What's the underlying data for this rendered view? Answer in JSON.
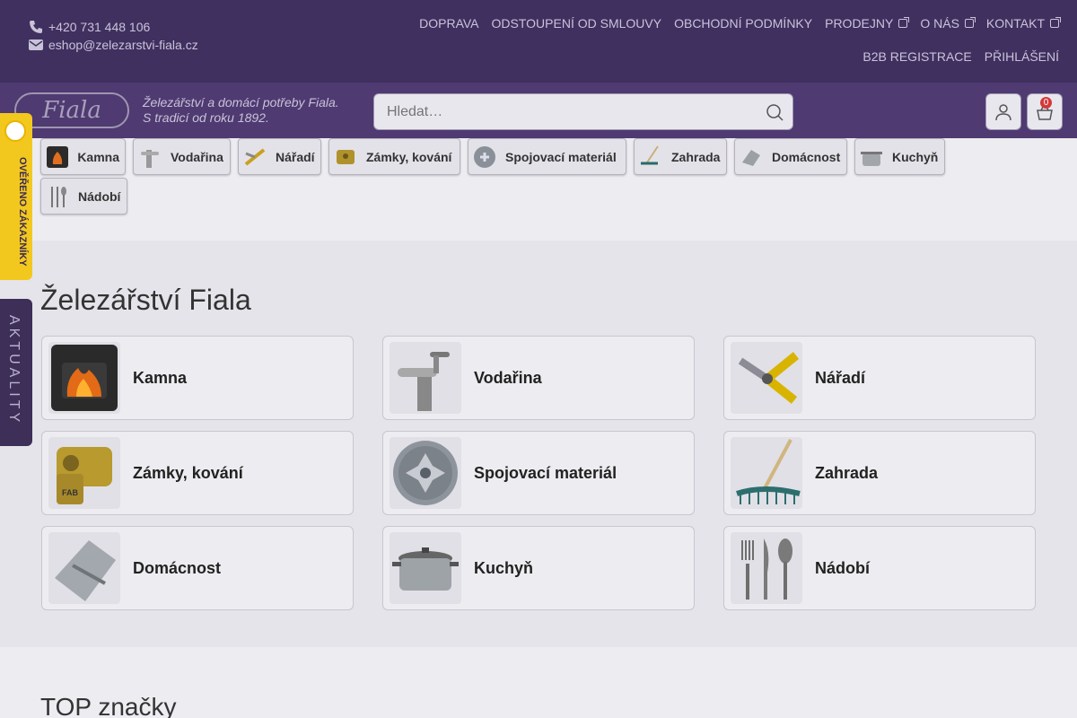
{
  "contact": {
    "phone": "+420 731 448 106",
    "email": "eshop@zelezarstvi-fiala.cz"
  },
  "topnav": [
    {
      "label": "DOPRAVA",
      "ext": false
    },
    {
      "label": "ODSTOUPENÍ OD SMLOUVY",
      "ext": false
    },
    {
      "label": "OBCHODNÍ PODMÍNKY",
      "ext": false
    },
    {
      "label": "PRODEJNY",
      "ext": true
    },
    {
      "label": "O NÁS",
      "ext": true
    },
    {
      "label": "KONTAKT",
      "ext": true
    }
  ],
  "subnav": [
    {
      "label": "B2B REGISTRACE"
    },
    {
      "label": "PŘIHLÁŠENÍ"
    }
  ],
  "logo": {
    "text": "Fiala"
  },
  "tagline": {
    "line1": "Železářství a domácí potřeby Fiala.",
    "line2": "S tradicí od roku 1892."
  },
  "search": {
    "placeholder": "Hledat…"
  },
  "cart": {
    "count": "0"
  },
  "pills": [
    {
      "label": "Kamna",
      "icon": "stove-icon"
    },
    {
      "label": "Vodařina",
      "icon": "faucet-icon"
    },
    {
      "label": "Nářadí",
      "icon": "pliers-icon"
    },
    {
      "label": "Zámky, kování",
      "icon": "lock-icon"
    },
    {
      "label": "Spojovací materiál",
      "icon": "screw-icon"
    },
    {
      "label": "Zahrada",
      "icon": "rake-icon"
    },
    {
      "label": "Domácnost",
      "icon": "dustpan-icon"
    },
    {
      "label": "Kuchyň",
      "icon": "pot-icon"
    },
    {
      "label": "Nádobí",
      "icon": "cutlery-icon"
    }
  ],
  "main": {
    "title": "Železářství Fiala",
    "cards": [
      {
        "label": "Kamna",
        "icon": "stove-icon"
      },
      {
        "label": "Vodařina",
        "icon": "faucet-icon"
      },
      {
        "label": "Nářadí",
        "icon": "pliers-icon"
      },
      {
        "label": "Zámky, kování",
        "icon": "lock-icon"
      },
      {
        "label": "Spojovací materiál",
        "icon": "screw-icon"
      },
      {
        "label": "Zahrada",
        "icon": "rake-icon"
      },
      {
        "label": "Domácnost",
        "icon": "dustpan-icon"
      },
      {
        "label": "Kuchyň",
        "icon": "pot-icon"
      },
      {
        "label": "Nádobí",
        "icon": "cutlery-icon"
      }
    ]
  },
  "brands": {
    "title": "TOP značky"
  },
  "side_tabs": {
    "verified": "OVĚŘENO ZÁKAZNÍKY",
    "news": "AKTUALITY"
  },
  "colors": {
    "header": "#403060",
    "band": "#4f3a72",
    "accent_yellow": "#f3c81e",
    "badge": "#d23a3a"
  }
}
